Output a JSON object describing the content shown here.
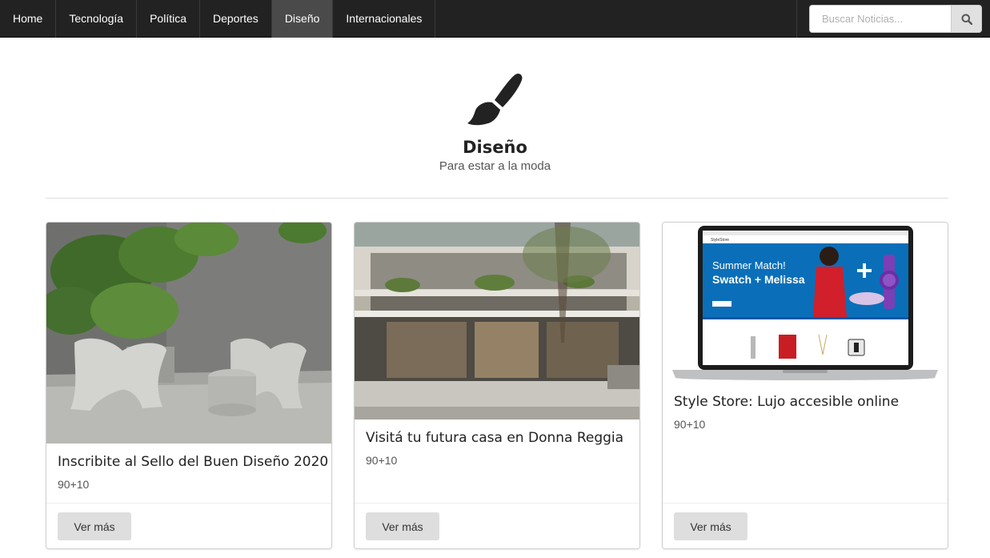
{
  "nav": {
    "items": [
      {
        "label": "Home",
        "active": false
      },
      {
        "label": "Tecnología",
        "active": false
      },
      {
        "label": "Política",
        "active": false
      },
      {
        "label": "Deportes",
        "active": false
      },
      {
        "label": "Diseño",
        "active": true
      },
      {
        "label": "Internacionales",
        "active": false
      }
    ],
    "search": {
      "placeholder": "Buscar Noticias...",
      "icon": "search-icon"
    }
  },
  "header": {
    "icon": "paint-brush-icon",
    "title": "Diseño",
    "subtitle": "Para estar a la moda"
  },
  "cards": [
    {
      "title": "Inscribite al Sello del Buen Diseño 2020",
      "meta": "90+10",
      "button": "Ver más",
      "image": "concrete-chairs-plants-photo"
    },
    {
      "title": "Visitá tu futura casa en Donna Reggia",
      "meta": "90+10",
      "button": "Ver más",
      "image": "building-facade-render"
    },
    {
      "title": "Style Store: Lujo accesible online",
      "meta": "90+10",
      "button": "Ver más",
      "image": "laptop-store-screenshot"
    }
  ],
  "laptop_screen": {
    "headline1": "Summer Match!",
    "headline2": "Swatch + Melissa",
    "store_name": "StyleStore"
  },
  "colors": {
    "navbar_bg": "#222222",
    "nav_active_bg": "#4a4a4a",
    "button_bg": "#dedede",
    "banner_blue": "#0a6fb8"
  }
}
